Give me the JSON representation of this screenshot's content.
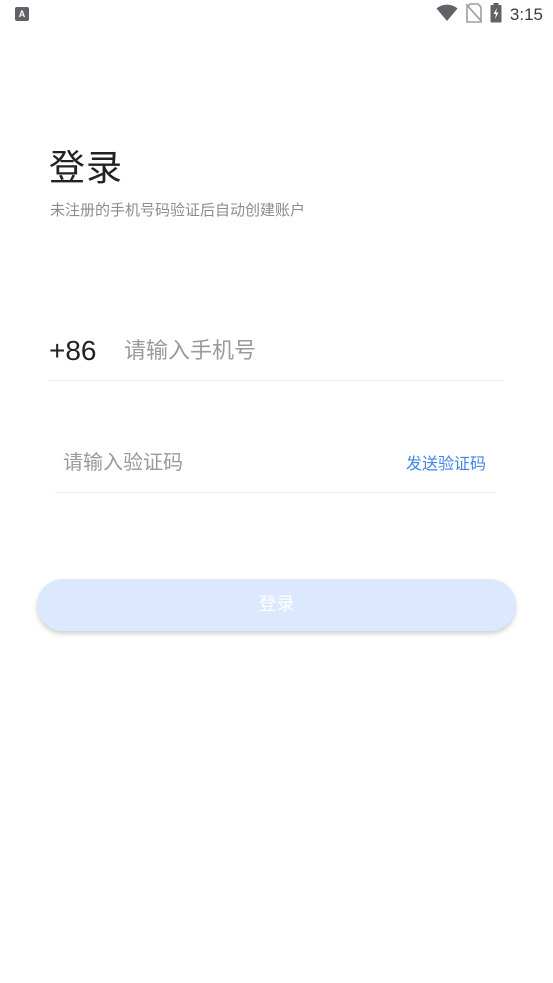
{
  "status_bar": {
    "left_icon": "A",
    "left_icon_name": "keyboard-indicator-icon",
    "icons": [
      "wifi-icon",
      "no-sim-icon",
      "battery-charging-icon"
    ],
    "time": "3:15"
  },
  "login": {
    "title": "登录",
    "subtitle": "未注册的手机号码验证后自动创建账户"
  },
  "phone": {
    "country_code": "+86",
    "placeholder": "请输入手机号",
    "value": ""
  },
  "code": {
    "placeholder": "请输入验证码",
    "value": "",
    "send_label": "发送验证码"
  },
  "submit": {
    "label": "登录"
  },
  "colors": {
    "accent": "#3f86e6",
    "button_bg": "#dbe8fd",
    "placeholder": "#9a9a9a",
    "divider": "#eeeeee"
  }
}
